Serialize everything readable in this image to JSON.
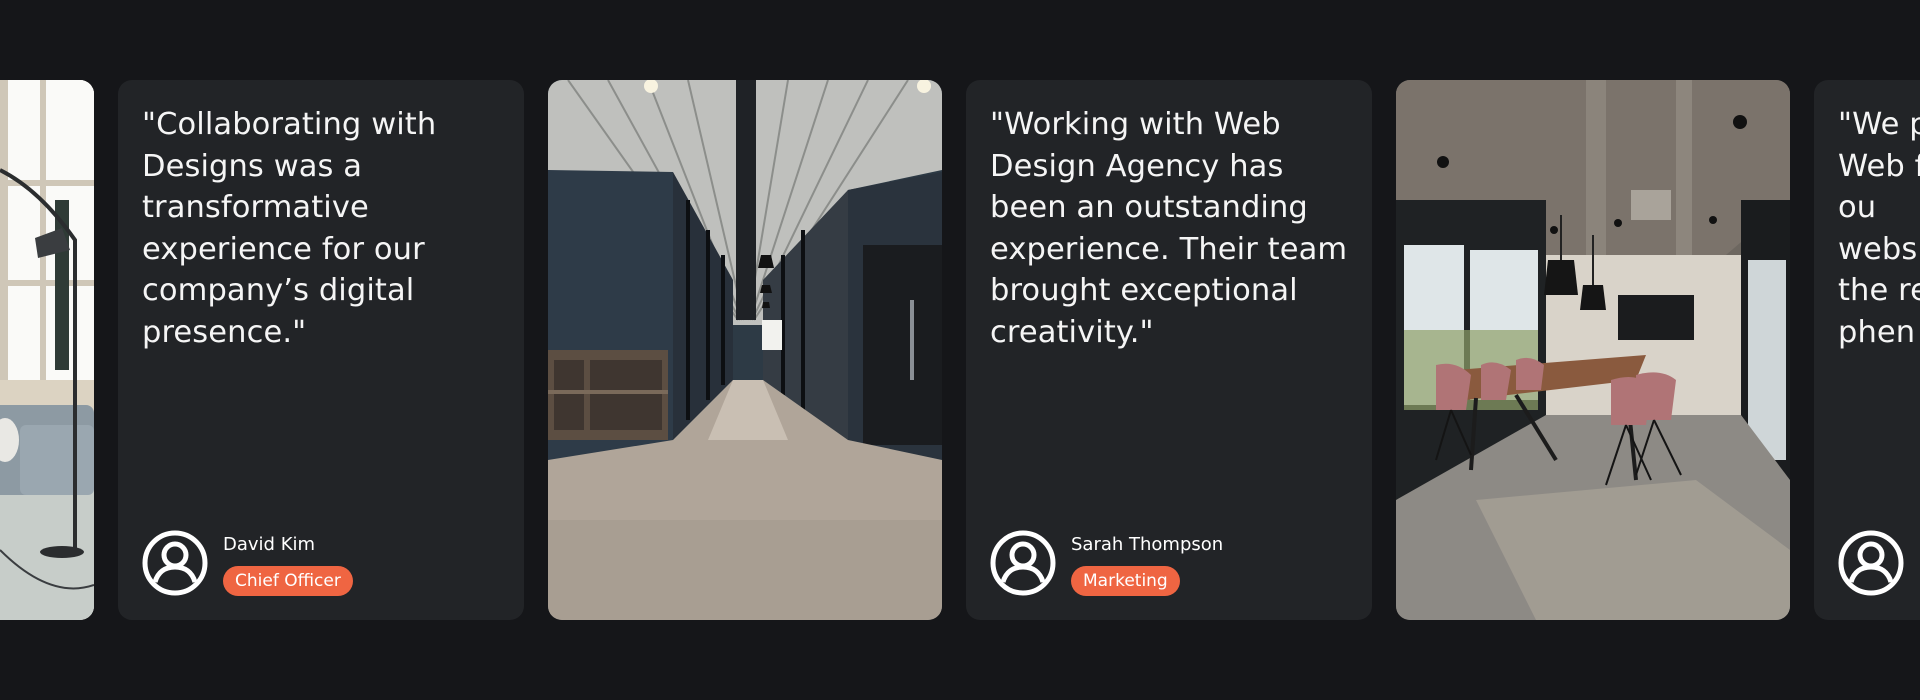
{
  "testimonials": [
    {
      "quote": "\"Collaborating with Designs was a transformative experience for our company’s digital presence.\"",
      "name": "David Kim",
      "role": "Chief Officer"
    },
    {
      "quote": "\"Working with Web Design Agency has been an outstanding experience. Their team brought exceptional creativity.\"",
      "name": "Sarah Thompson",
      "role": "Marketing"
    },
    {
      "quote": "\"We p Web for ou webs the re phen",
      "name": "",
      "role": ""
    }
  ],
  "icons": {
    "avatar": "user-circle-icon"
  },
  "colors": {
    "page_background": "#151619",
    "card_background": "#222427",
    "role_badge": "#ef6542",
    "text": "#ffffff"
  }
}
